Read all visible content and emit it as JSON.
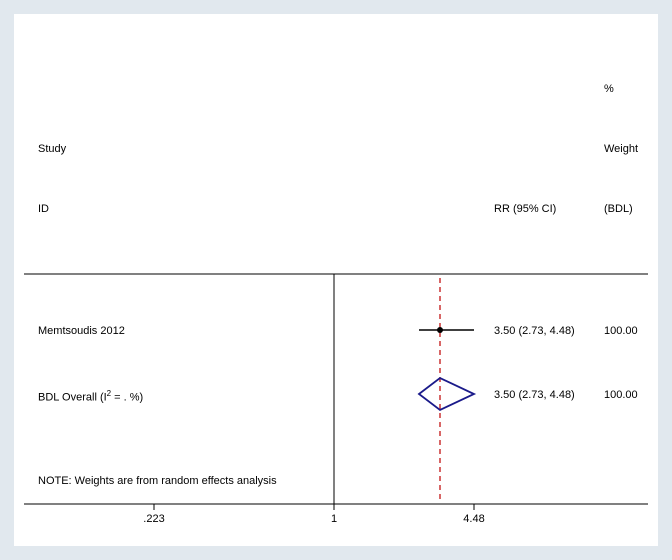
{
  "header": {
    "col_study": "Study",
    "col_id": "ID",
    "col_effect": "RR (95% CI)",
    "col_weight_pct": "%",
    "col_weight_label": "Weight",
    "col_weight_unit": "(BDL)"
  },
  "rows": {
    "study1_label": "Memtsoudis 2012",
    "study1_rr_ci": "3.50 (2.73, 4.48)",
    "study1_weight": "100.00",
    "overall_label_prefix": "BDL Overall  (I",
    "overall_label_exp": "2",
    "overall_label_suffix": " =  . %)",
    "overall_rr_ci": "3.50 (2.73, 4.48)",
    "overall_weight": "100.00"
  },
  "note": "NOTE: Weights are from random effects analysis",
  "axis_ticks": {
    "t1": ".223",
    "t2": "1",
    "t3": "4.48"
  },
  "chart_data": {
    "type": "forest",
    "title": "",
    "x_scale": "log",
    "x_ticks": [
      0.223,
      1,
      4.48
    ],
    "columns": [
      "Study ID",
      "RR (95% CI)",
      "% Weight (BDL)"
    ],
    "null_line": 1,
    "reference_line": 3.5,
    "series": [
      {
        "name": "Memtsoudis 2012",
        "rr": 3.5,
        "ci_low": 2.73,
        "ci_high": 4.48,
        "weight_pct": 100.0,
        "type": "study"
      },
      {
        "name": "BDL Overall (I2 = . %)",
        "rr": 3.5,
        "ci_low": 2.73,
        "ci_high": 4.48,
        "weight_pct": 100.0,
        "type": "overall"
      }
    ],
    "note": "Weights are from random effects analysis"
  }
}
